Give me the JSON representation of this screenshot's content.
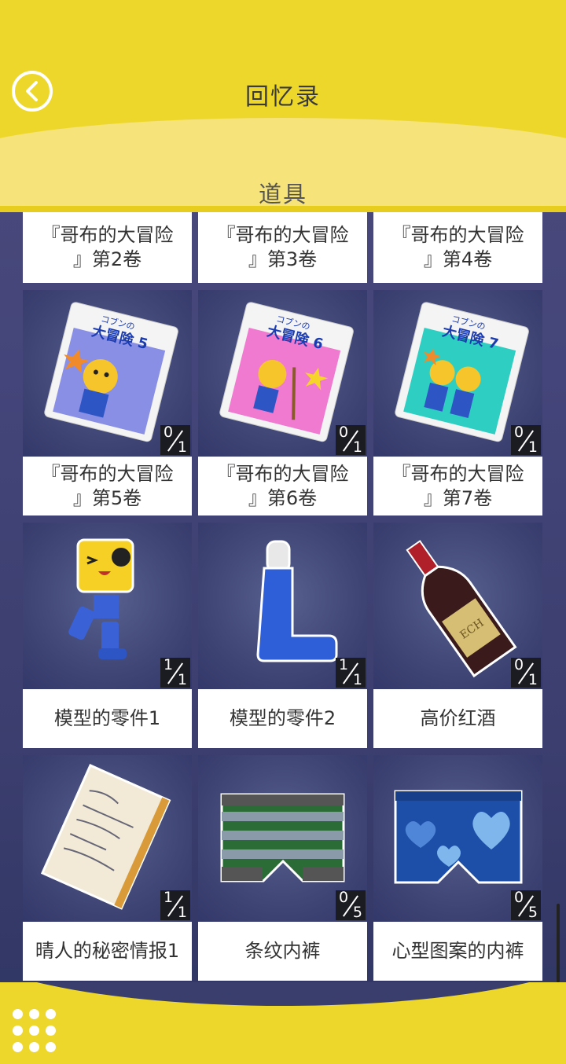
{
  "header": {
    "title": "回忆录",
    "section": "道具"
  },
  "items": [
    {
      "id": "book2",
      "label": "『哥布的大冒险\n』第2卷"
    },
    {
      "id": "book3",
      "label": "『哥布的大冒险\n』第3卷"
    },
    {
      "id": "book4",
      "label": "『哥布的大冒险\n』第4卷"
    },
    {
      "id": "book5",
      "label": "『哥布的大冒险\n』第5卷",
      "owned": "0",
      "total": "1",
      "cover_title": "コブンの",
      "cover_big": "大冒険 5"
    },
    {
      "id": "book6",
      "label": "『哥布的大冒险\n』第6卷",
      "owned": "0",
      "total": "1",
      "cover_title": "コブンの",
      "cover_big": "大冒険 6"
    },
    {
      "id": "book7",
      "label": "『哥布的大冒险\n』第7卷",
      "owned": "0",
      "total": "1",
      "cover_title": "コブンの",
      "cover_big": "大冒険 7"
    },
    {
      "id": "part1",
      "label": "模型的零件1",
      "owned": "1",
      "total": "1"
    },
    {
      "id": "part2",
      "label": "模型的零件2",
      "owned": "1",
      "total": "1"
    },
    {
      "id": "wine",
      "label": "高价红酒",
      "owned": "0",
      "total": "1",
      "bottle_label": "ECH"
    },
    {
      "id": "notes",
      "label": "晴人的秘密情报1",
      "owned": "1",
      "total": "1"
    },
    {
      "id": "stripes",
      "label": "条纹内裤",
      "owned": "0",
      "total": "5"
    },
    {
      "id": "hearts",
      "label": "心型图案的内裤",
      "owned": "0",
      "total": "5"
    }
  ],
  "colors": {
    "header_yellow": "#edd72a",
    "header_light": "#f6e37a",
    "panel_bg": "#44457a"
  }
}
